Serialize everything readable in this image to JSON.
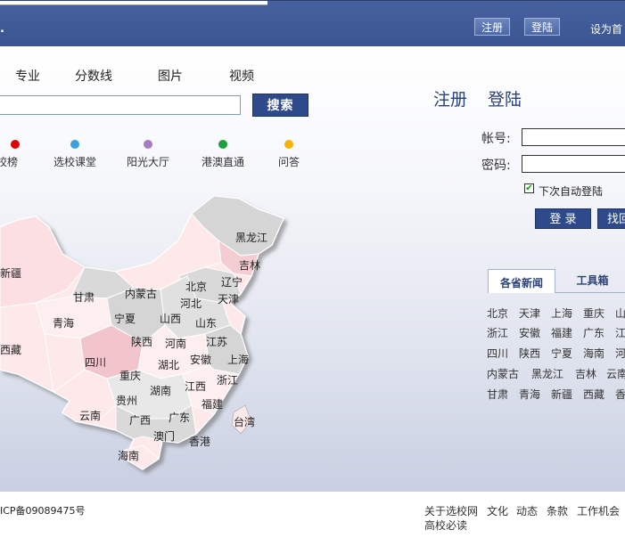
{
  "header": {
    "logo_fragment": ".",
    "register_label": "注册",
    "login_label": "登陆",
    "set_home_label": "设为首"
  },
  "nav": {
    "tabs": [
      "专业",
      "分数线",
      "图片",
      "视频"
    ]
  },
  "search": {
    "placeholder": "",
    "button_label": "搜索"
  },
  "quick_links": [
    {
      "label": "校榜",
      "color": "#e00000"
    },
    {
      "label": "选校课堂",
      "color": "#3aa1da"
    },
    {
      "label": "阳光大厅",
      "color": "#a77bbf"
    },
    {
      "label": "港澳直通",
      "color": "#1f9e3d"
    },
    {
      "label": "问答",
      "color": "#f5b400"
    }
  ],
  "map": {
    "provinces": [
      {
        "label": "黑龙江"
      },
      {
        "label": "吉林"
      },
      {
        "label": "新疆"
      },
      {
        "label": "甘肃"
      },
      {
        "label": "内蒙古"
      },
      {
        "label": "北京"
      },
      {
        "label": "辽宁"
      },
      {
        "label": "河北"
      },
      {
        "label": "天津"
      },
      {
        "label": "青海"
      },
      {
        "label": "宁夏"
      },
      {
        "label": "山西"
      },
      {
        "label": "山东"
      },
      {
        "label": "西藏"
      },
      {
        "label": "陕西"
      },
      {
        "label": "河南"
      },
      {
        "label": "江苏"
      },
      {
        "label": "四川"
      },
      {
        "label": "湖北"
      },
      {
        "label": "安徽"
      },
      {
        "label": "上海"
      },
      {
        "label": "重庆"
      },
      {
        "label": "浙江"
      },
      {
        "label": "湖南"
      },
      {
        "label": "江西"
      },
      {
        "label": "贵州"
      },
      {
        "label": "福建"
      },
      {
        "label": "云南"
      },
      {
        "label": "广西"
      },
      {
        "label": "广东"
      },
      {
        "label": "台湾"
      },
      {
        "label": "澳门"
      },
      {
        "label": "香港"
      },
      {
        "label": "海南"
      }
    ]
  },
  "login": {
    "register_title": "注册",
    "login_title": "登陆",
    "account_label": "帐号:",
    "password_label": "密码:",
    "account_value": "",
    "password_value": "",
    "remember_checked": true,
    "remember_label": "下次自动登陆",
    "login_button": "登 录",
    "recover_button": "找回"
  },
  "news": {
    "tabs": [
      "各省新闻",
      "工具箱"
    ],
    "active_tab": "各省新闻",
    "rows": [
      [
        "北京",
        "天津",
        "上海",
        "重庆",
        "山"
      ],
      [
        "浙江",
        "安徽",
        "福建",
        "广东",
        "江"
      ],
      [
        "四川",
        "陕西",
        "宁夏",
        "海南",
        "河"
      ],
      [
        "内蒙古",
        "黑龙江",
        "吉林",
        "云南"
      ],
      [
        "甘肃",
        "青海",
        "新疆",
        "西藏",
        "香"
      ]
    ]
  },
  "footer": {
    "icp": "ICP备09089475号",
    "links": [
      "关于选校网",
      "文化",
      "动态",
      "条款",
      "工作机会",
      "高校必读"
    ]
  }
}
